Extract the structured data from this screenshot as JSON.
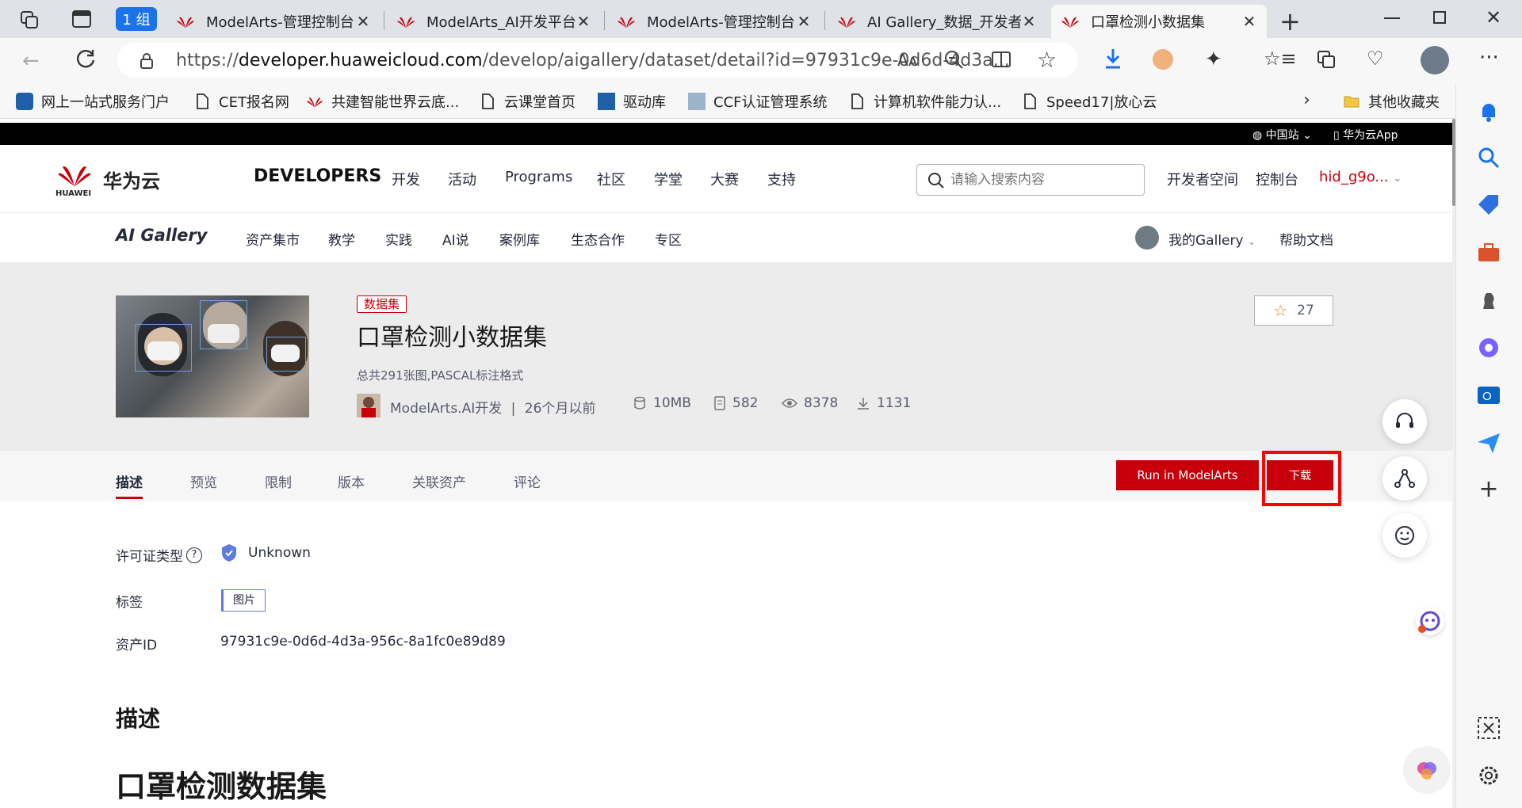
{
  "browser": {
    "tab_group": "1 组",
    "tabs": [
      {
        "title": "ModelArts-管理控制台"
      },
      {
        "title": "ModelArts_AI开发平台"
      },
      {
        "title": "ModelArts-管理控制台"
      },
      {
        "title": "AI Gallery_数据_开发者"
      },
      {
        "title": "口罩检测小数据集"
      }
    ],
    "url_prefix": "https://",
    "url_host": "developer.huaweicloud.com",
    "url_path": "/develop/aigallery/dataset/detail?id=97931c9e-0d6d-4d3a...",
    "bookmarks": [
      "网上一站式服务门户",
      "CET报名网",
      "共建智能世界云底...",
      "云课堂首页",
      "驱动库",
      "CCF认证管理系统",
      "计算机软件能力认...",
      "Speed17|放心云"
    ],
    "other_bookmarks": "其他收藏夹"
  },
  "site": {
    "top_links": {
      "region": "中国站",
      "app": "华为云App"
    },
    "brand_text": "华为云",
    "brand_sub": "HUAWEI",
    "developers": "DEVELOPERS",
    "nav": [
      "开发",
      "活动",
      "Programs",
      "社区",
      "学堂",
      "大赛",
      "支持"
    ],
    "search_placeholder": "请输入搜索内容",
    "right_nav": [
      "开发者空间",
      "控制台"
    ],
    "user": "hid_g9o..."
  },
  "gallery": {
    "logo": "AI Gallery",
    "nav": [
      "资产集市",
      "教学",
      "实践",
      "AI说",
      "案例库",
      "生态合作",
      "专区"
    ],
    "my_gallery": "我的Gallery",
    "help": "帮助文档"
  },
  "dataset": {
    "badge": "数据集",
    "title": "口罩检测小数据集",
    "summary": "总共291张图,PASCAL标注格式",
    "author": "ModelArts.AI开发",
    "time": "26个月以前",
    "size": "10MB",
    "files": "582",
    "views": "8378",
    "downloads": "1131",
    "stars": "27"
  },
  "detail_tabs": [
    "描述",
    "预览",
    "限制",
    "版本",
    "关联资产",
    "评论"
  ],
  "actions": {
    "run": "Run in ModelArts",
    "download": "下载"
  },
  "info": {
    "license_label": "许可证类型",
    "license_value": "Unknown",
    "tags_label": "标签",
    "tag": "图片",
    "id_label": "资产ID",
    "id_value": "97931c9e-0d6d-4d3a-956c-8a1fc0e89d89"
  },
  "content": {
    "heading": "描述",
    "h1": "口罩检测数据集"
  },
  "colors": {
    "accent": "#c7000b",
    "highlight": "#ff0000",
    "link": "#c7000b"
  }
}
